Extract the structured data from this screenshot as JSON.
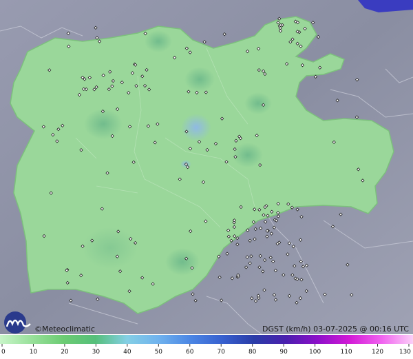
{
  "map": {
    "brand": "©Meteoclimatic",
    "variable_label": "DGST (km/h)  03-07-2025 @ 00:16 UTC",
    "colors": {
      "background_terrain": "#8e93a6",
      "region_fill": "#9ad79a",
      "region_edge": "#7cc07c",
      "hotspot": "#8fb8e8",
      "station_marker": "#222222",
      "logo": "#2a3a8c"
    }
  },
  "scale": {
    "ticks": [
      "0",
      "10",
      "20",
      "30",
      "40",
      "50",
      "60",
      "70",
      "80",
      "90",
      "100",
      "110",
      "120",
      "130"
    ],
    "colors": [
      "#c8f5c8",
      "#98e09a",
      "#6ccc73",
      "#55bf7a",
      "#84cfe5",
      "#6fb2ee",
      "#4b86e4",
      "#3760cf",
      "#2a3ca8",
      "#4a1fae",
      "#8c0fc9",
      "#d21ad6",
      "#f062ef",
      "#fbcff8"
    ]
  }
}
